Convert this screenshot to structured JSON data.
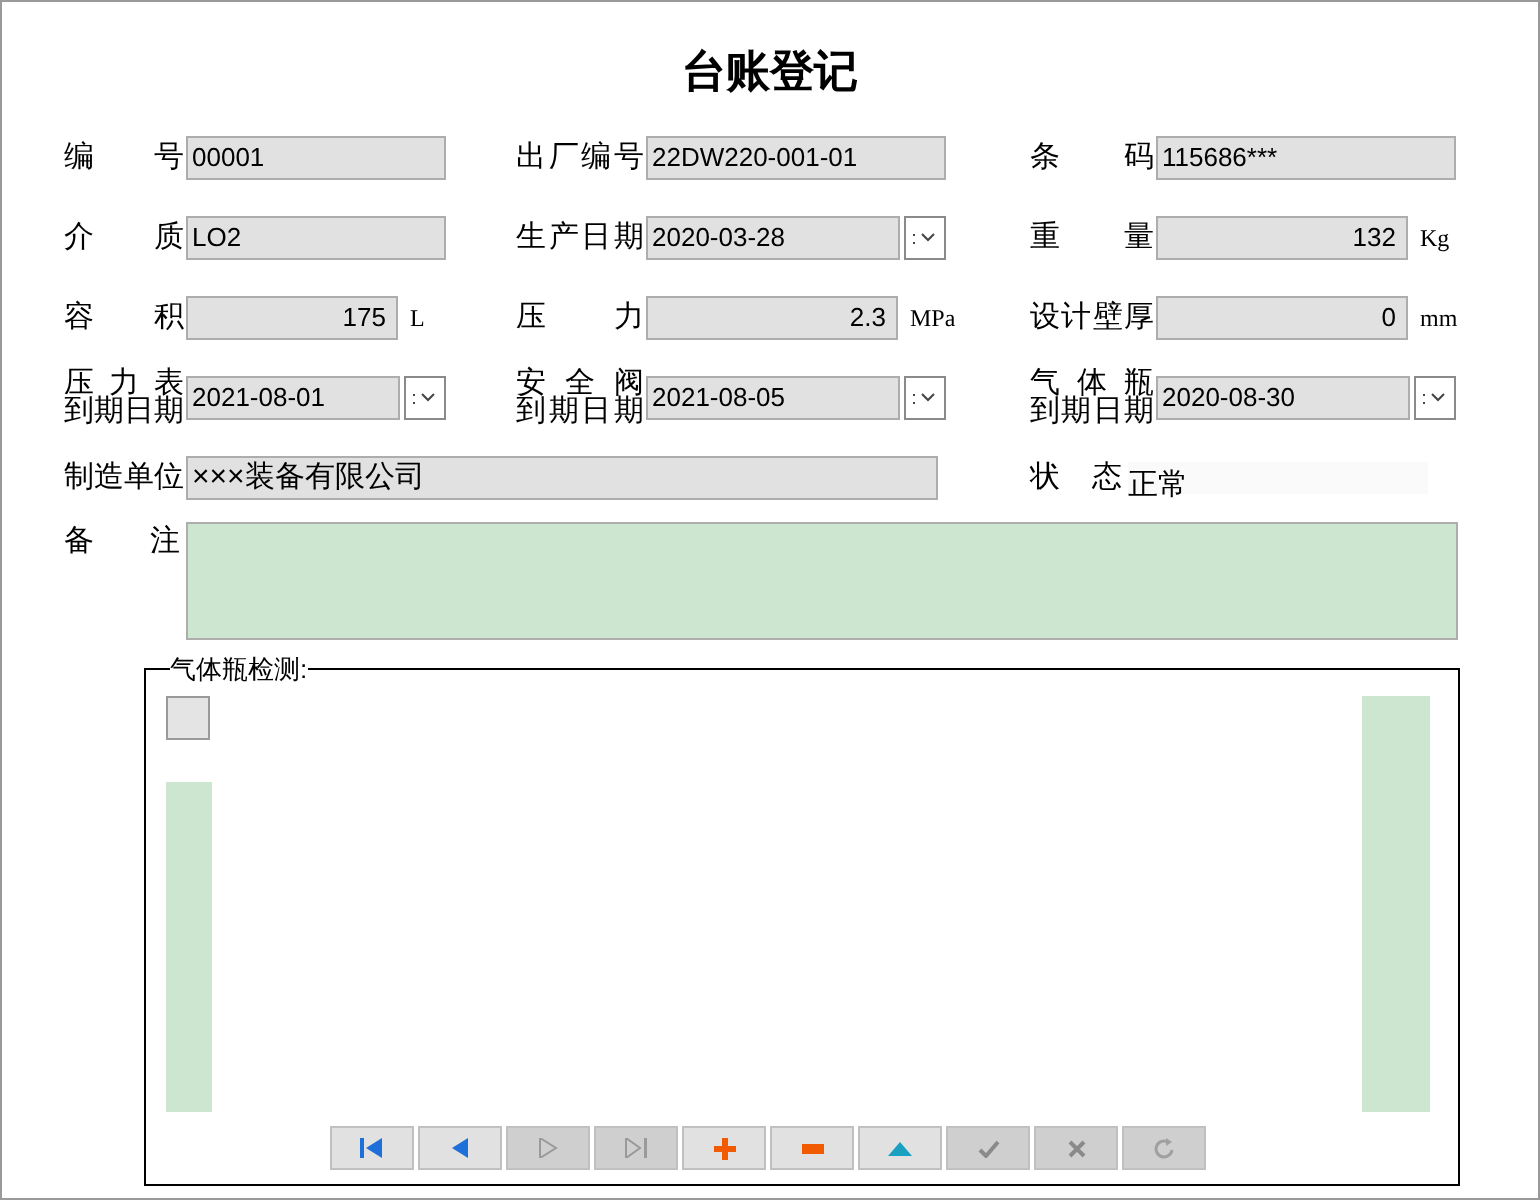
{
  "title": "台账登记",
  "rows": [
    [
      {
        "kind": "text",
        "label": "编号",
        "value": "00001"
      },
      {
        "kind": "text",
        "label": "出厂编号",
        "value": "22DW220-001-01"
      },
      {
        "kind": "text",
        "label": "条码",
        "value": "115686***"
      }
    ],
    [
      {
        "kind": "text",
        "label": "介质",
        "value": "LO2"
      },
      {
        "kind": "date",
        "label": "生产日期",
        "value": "2020-03-28"
      },
      {
        "kind": "number",
        "label": "重量",
        "value": "132",
        "unit": "Kg"
      }
    ],
    [
      {
        "kind": "number",
        "label": "容积",
        "value": "175",
        "unit": "L"
      },
      {
        "kind": "number",
        "label": "压力",
        "value": "2.3",
        "unit": "MPa"
      },
      {
        "kind": "number",
        "label": "设计壁厚",
        "value": "0",
        "unit": "mm"
      }
    ],
    [
      {
        "kind": "date",
        "label": "压力表",
        "sublabel": "到期日期",
        "value": "2021-08-01"
      },
      {
        "kind": "date",
        "label": "安全阀",
        "sublabel": "到期日期",
        "value": "2021-08-05"
      },
      {
        "kind": "date",
        "label": "气体瓶",
        "sublabel": "到期日期",
        "value": "2020-08-30"
      }
    ],
    [
      {
        "kind": "wide",
        "label": "制造单位",
        "value": "×××装备有限公司"
      },
      {
        "kind": "plain",
        "label": "状态",
        "value": "正常"
      }
    ]
  ],
  "remark": {
    "label": "备注"
  },
  "inspection": {
    "caption": "气体瓶检测:"
  },
  "navigator": [
    {
      "kind": "first",
      "disabled": false
    },
    {
      "kind": "prev",
      "disabled": false
    },
    {
      "kind": "next",
      "disabled": true
    },
    {
      "kind": "last",
      "disabled": true
    },
    {
      "kind": "add",
      "disabled": false
    },
    {
      "kind": "delete",
      "disabled": false
    },
    {
      "kind": "edit",
      "disabled": false
    },
    {
      "kind": "post",
      "disabled": true
    },
    {
      "kind": "cancel",
      "disabled": true
    },
    {
      "kind": "refresh",
      "disabled": true
    }
  ]
}
